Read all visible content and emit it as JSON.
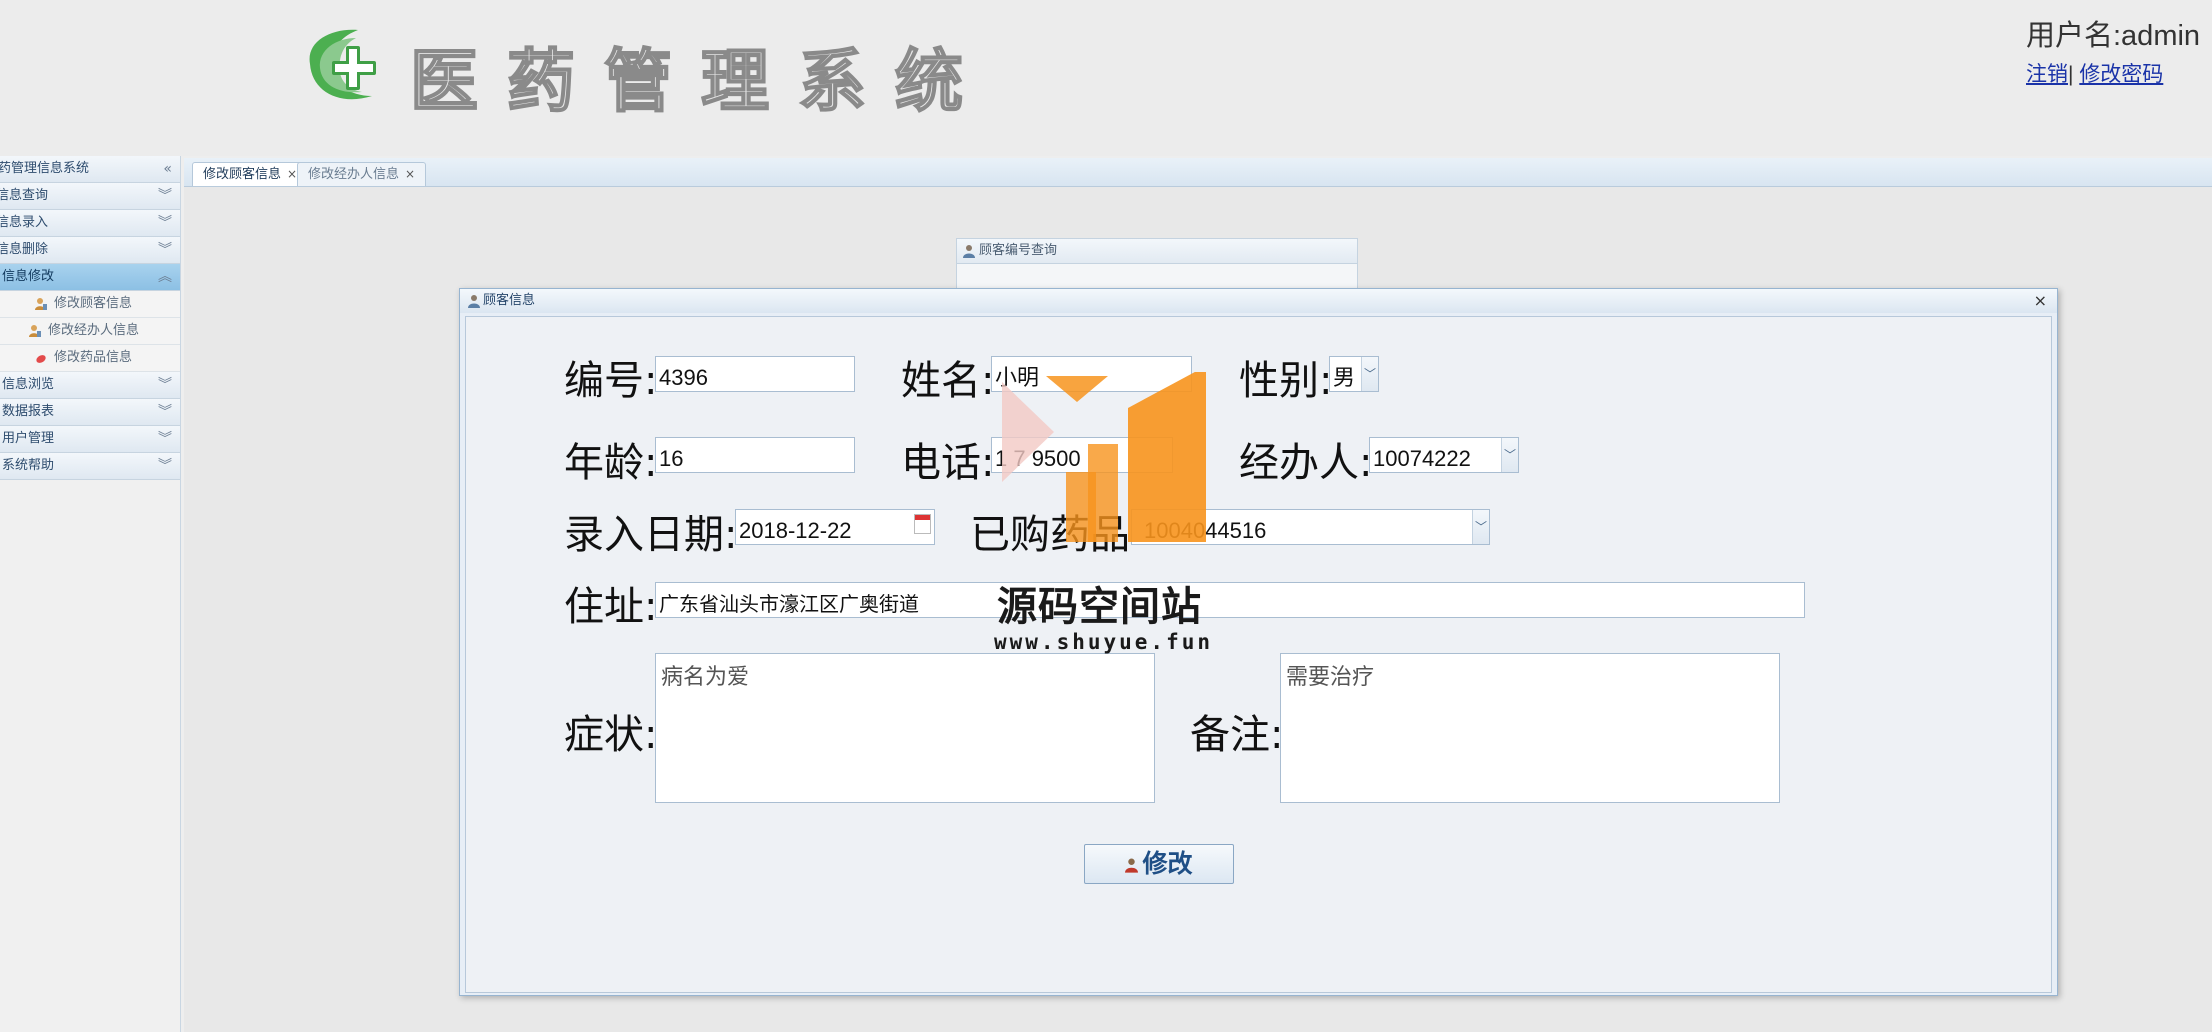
{
  "header": {
    "logo_icon": "green-cross-logo-icon",
    "logo_text": "医药管理系统",
    "user_label": "用户名:admin",
    "logout_link": "注销",
    "separator": "|",
    "change_password_link": "修改密码"
  },
  "sidebar": {
    "title": "药管理信息系统",
    "sections": [
      {
        "label": "信息查询"
      },
      {
        "label": "信息录入"
      },
      {
        "label": "信息删除"
      },
      {
        "label": "信息修改",
        "active": true,
        "items": [
          {
            "label": "修改顾客信息",
            "icon": "user-edit-icon"
          },
          {
            "label": "修改经办人信息",
            "icon": "user-edit-icon"
          },
          {
            "label": "修改药品信息",
            "icon": "pill-icon"
          }
        ]
      },
      {
        "label": "信息浏览"
      },
      {
        "label": "数据报表"
      },
      {
        "label": "用户管理"
      },
      {
        "label": "系统帮助"
      }
    ]
  },
  "tabs": [
    {
      "label": "修改顾客信息",
      "selected": true,
      "close": "×"
    },
    {
      "label": "修改经办人信息",
      "selected": false,
      "close": "×"
    }
  ],
  "background_panel": {
    "title": "顾客编号查询"
  },
  "dialog": {
    "title": "顾客信息",
    "close": "×",
    "labels": {
      "id": "编号:",
      "name": "姓名:",
      "gender": "性别:",
      "age": "年龄:",
      "phone": "电话:",
      "agent": "经办人:",
      "date": "录入日期:",
      "medicine": "已购药品",
      "address": "住址:",
      "symptom": "症状:",
      "remark": "备注:"
    },
    "values": {
      "id": "4396",
      "name": "小明",
      "gender": "男",
      "age": "16",
      "phone": "1   7   9500",
      "agent": "10074222",
      "date": "2018-12-22",
      "medicine": "1004044516",
      "address": "广东省汕头市濠江区广奥街道",
      "symptom": "病名为爱",
      "remark": "需要治疗"
    },
    "submit_button": "修改",
    "submit_icon": "user-icon"
  },
  "watermark": {
    "title": "源码空间站",
    "url": "www.shuyue.fun",
    "colors": {
      "orange": "#f7941d",
      "pink": "#f2c9c4"
    }
  },
  "colors": {
    "accent": "#8cc0e4",
    "logo_green": "#4caf50",
    "link": "#1a33a8"
  }
}
